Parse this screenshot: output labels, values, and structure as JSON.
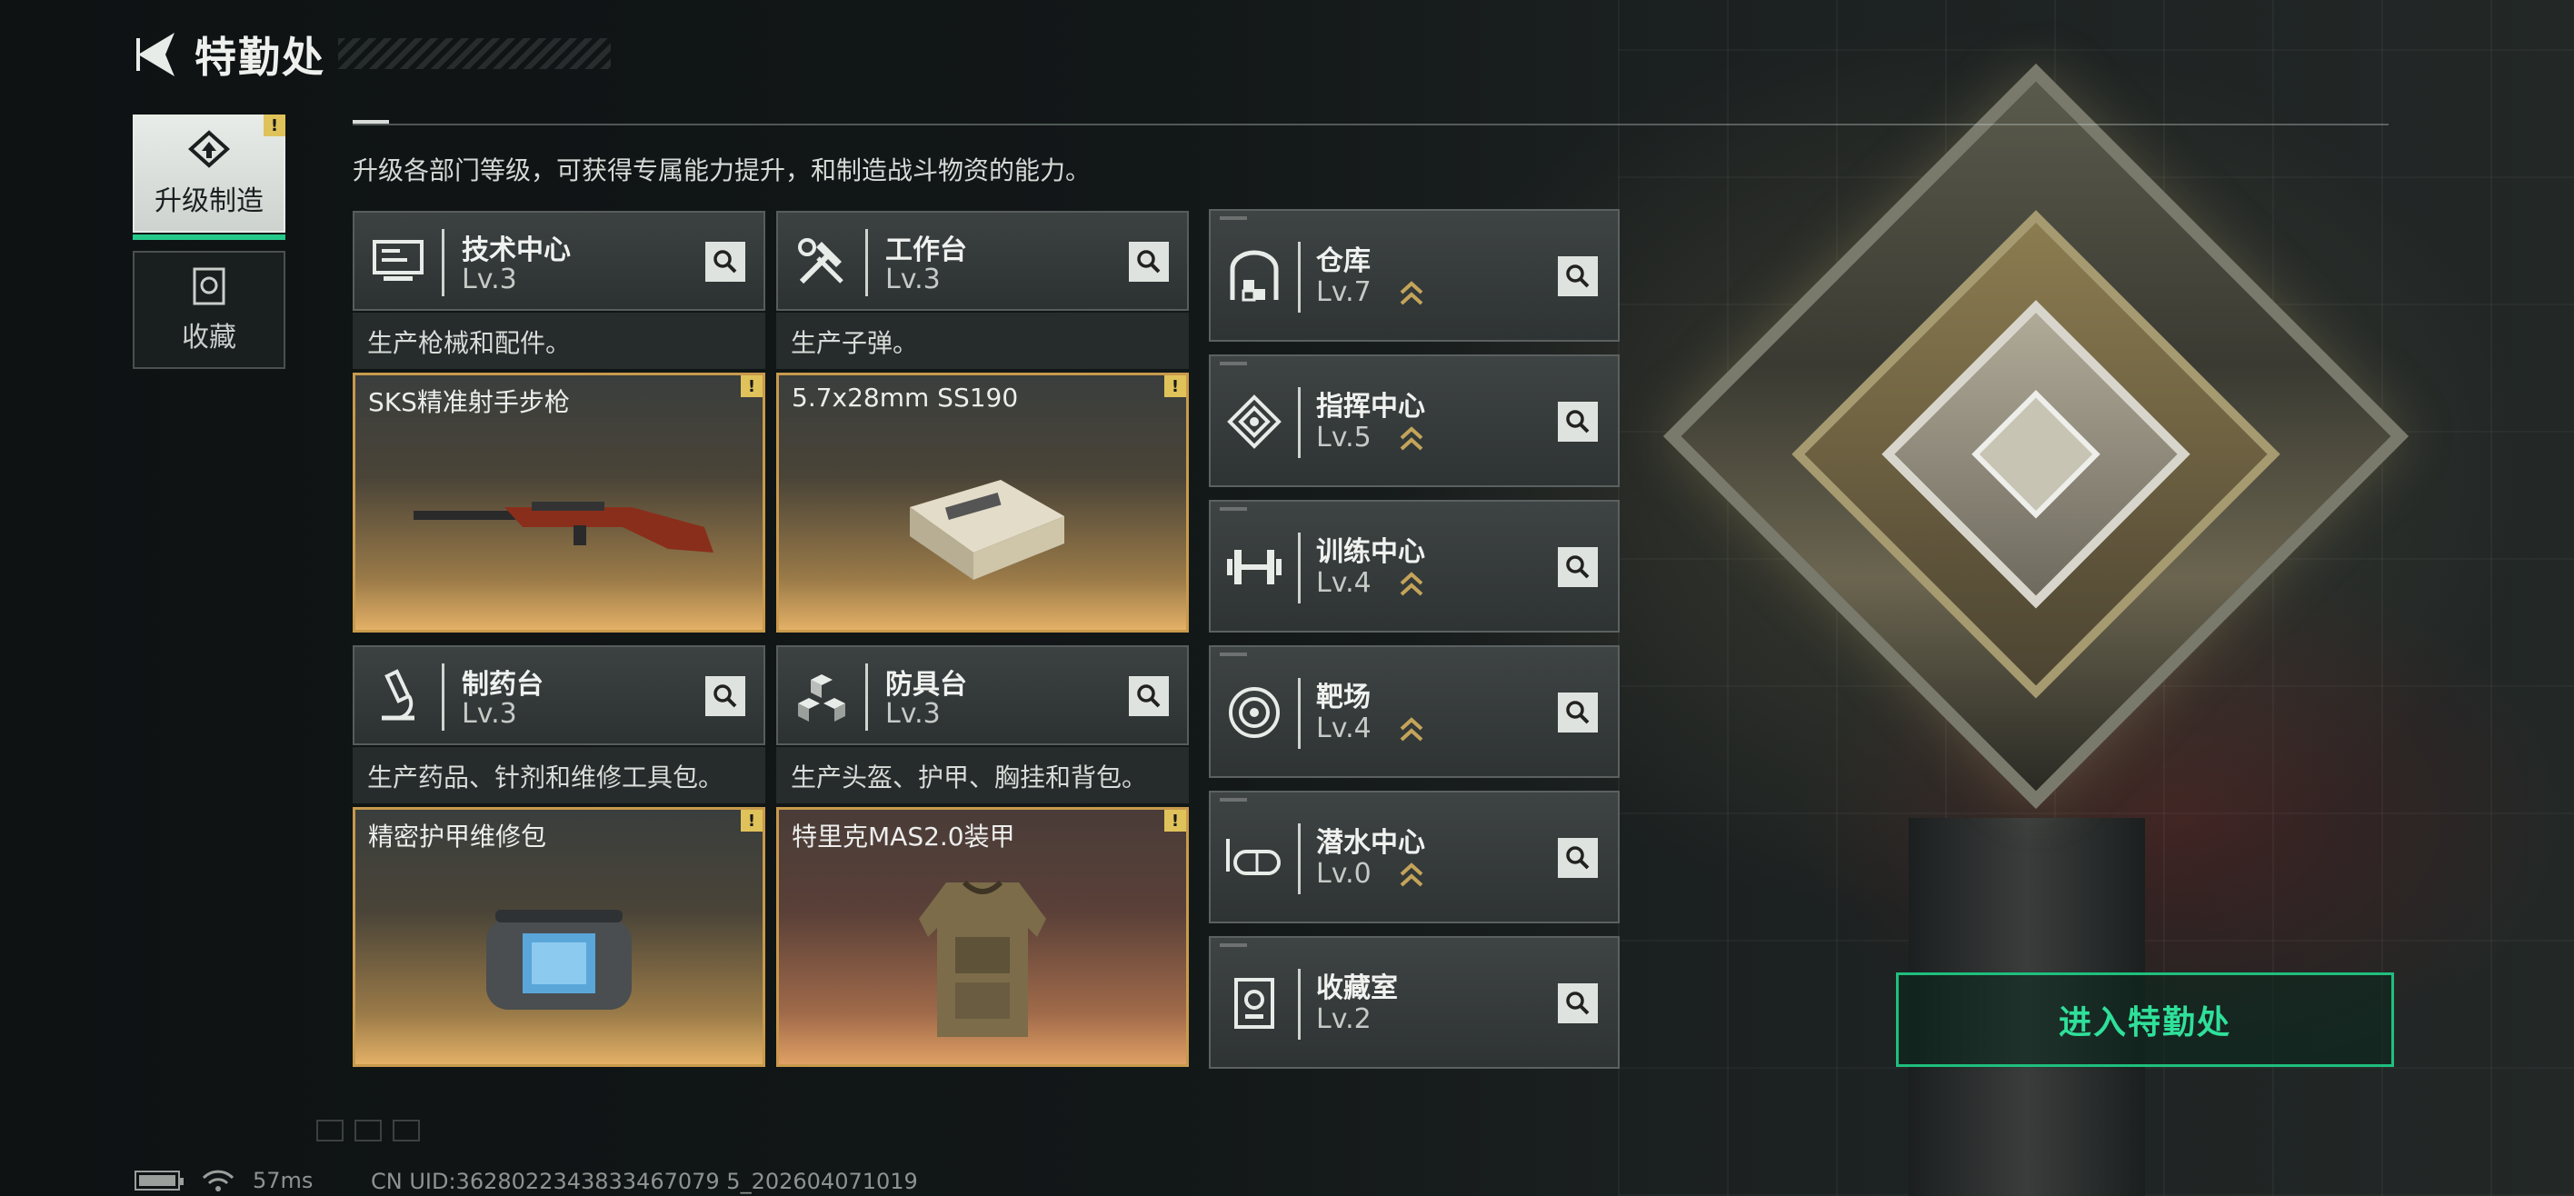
{
  "header": {
    "title": "特勤处"
  },
  "tabs": [
    {
      "label": "升级制造",
      "active": true,
      "badge": "!"
    },
    {
      "label": "收藏",
      "active": false
    }
  ],
  "description": "升级各部门等级，可获得专属能力提升，和制造战斗物资的能力。",
  "departments": [
    {
      "name": "技术中心",
      "level": "Lv.3",
      "desc": "生产枪械和配件。",
      "item": "SKS精准射手步枪",
      "badge": "!",
      "icon": "computer-icon"
    },
    {
      "name": "工作台",
      "level": "Lv.3",
      "desc": "生产子弹。",
      "item": "5.7x28mm SS190",
      "badge": "!",
      "icon": "tools-icon"
    },
    {
      "name": "制药台",
      "level": "Lv.3",
      "desc": "生产药品、针剂和维修工具包。",
      "item": "精密护甲维修包",
      "badge": "!",
      "icon": "microscope-icon"
    },
    {
      "name": "防具台",
      "level": "Lv.3",
      "desc": "生产头盔、护甲、胸挂和背包。",
      "item": "特里克MAS2.0装甲",
      "badge": "!",
      "icon": "cubes-icon"
    }
  ],
  "facilities": [
    {
      "name": "仓库",
      "level": "Lv.7",
      "upgradable": true,
      "icon": "warehouse-icon"
    },
    {
      "name": "指挥中心",
      "level": "Lv.5",
      "upgradable": true,
      "icon": "command-icon"
    },
    {
      "name": "训练中心",
      "level": "Lv.4",
      "upgradable": true,
      "icon": "dumbbell-icon"
    },
    {
      "name": "靶场",
      "level": "Lv.4",
      "upgradable": true,
      "icon": "target-icon"
    },
    {
      "name": "潜水中心",
      "level": "Lv.0",
      "upgradable": true,
      "icon": "diving-mask-icon"
    },
    {
      "name": "收藏室",
      "level": "Lv.2",
      "upgradable": false,
      "icon": "collection-icon"
    }
  ],
  "enter_button": "进入特勤处",
  "status": {
    "ping": "57ms",
    "uid": "CN UID:3628022343833467079 5_202604071019"
  },
  "colors": {
    "accent": "#24c98a",
    "item_border": "#c89a4c",
    "badge": "#e0c25a"
  }
}
